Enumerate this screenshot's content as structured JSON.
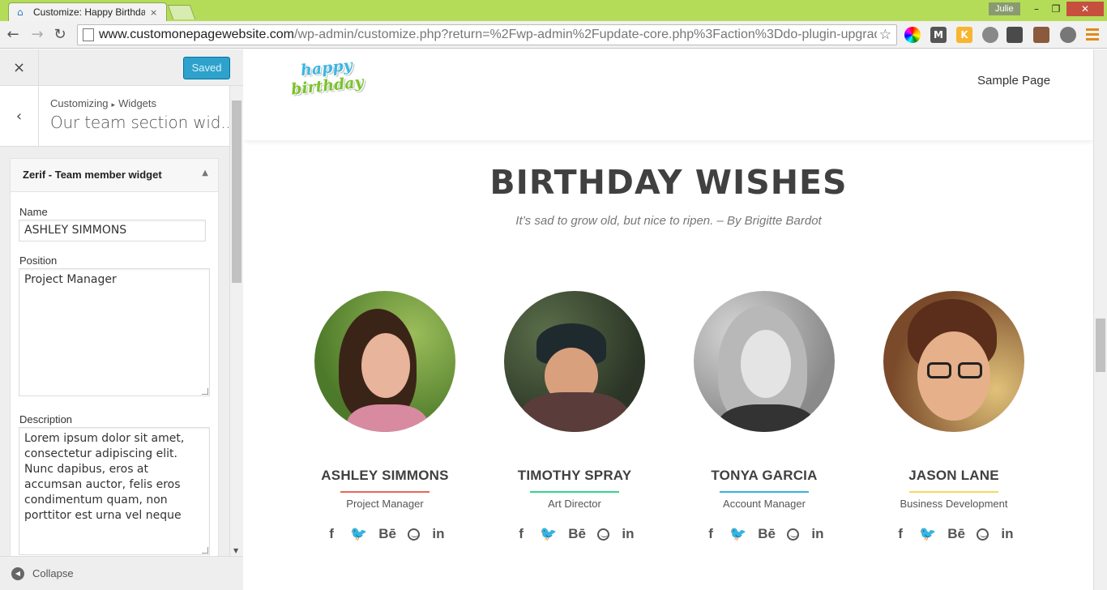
{
  "browser": {
    "tab_title": "Customize: Happy Birthday",
    "tab_close": "×",
    "user": "Julie",
    "win_min": "–",
    "win_max": "❐",
    "win_close": "✕",
    "back": "←",
    "forward": "→",
    "reload": "↻",
    "url_host": "www.customonepagewebsite.com",
    "url_path": "/wp-admin/customize.php?return=%2Fwp-admin%2Fupdate-core.php%3Faction%3Ddo-plugin-upgrade",
    "star": "☆",
    "ext_m": "M",
    "ext_k": "K"
  },
  "sidebar": {
    "close": "×",
    "saved_label": "Saved",
    "back": "‹",
    "breadcrumb_root": "Customizing",
    "breadcrumb_sep": "▸",
    "breadcrumb_leaf": "Widgets",
    "section_title": "Our team section wid...",
    "widget_title": "Zerif - Team member widget",
    "widget_toggle": "▲",
    "name_label": "Name",
    "name_value": "ASHLEY SIMMONS",
    "position_label": "Position",
    "position_value": "Project Manager",
    "description_label": "Description",
    "description_value": "Lorem ipsum dolor sit amet, consectetur adipiscing elit. Nunc dapibus, eros at accumsan auctor, felis eros condimentum quam, non porttitor est urna vel neque",
    "collapse_icon": "◀",
    "collapse_label": "Collapse"
  },
  "site": {
    "logo_top": "happy",
    "logo_bottom": "birthday",
    "nav_link": "Sample Page",
    "heading": "BIRTHDAY WISHES",
    "subheading": "It’s sad to grow old, but nice to ripen. – By Brigitte Bardot",
    "social": {
      "facebook": "f",
      "twitter": "🐦",
      "behance": "Bē",
      "linkedin": "in"
    },
    "members": [
      {
        "name": "ASHLEY SIMMONS",
        "role": "Project Manager",
        "line_color": "#e96656"
      },
      {
        "name": "TIMOTHY SPRAY",
        "role": "Art Director",
        "line_color": "#34d293"
      },
      {
        "name": "TONYA GARCIA",
        "role": "Account Manager",
        "line_color": "#3ab0e2"
      },
      {
        "name": "JASON LANE",
        "role": "Business Development",
        "line_color": "#f7d861"
      }
    ]
  }
}
